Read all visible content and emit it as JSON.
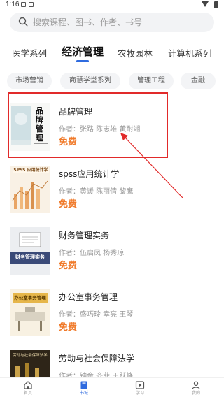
{
  "status_bar": {
    "time": "1:16"
  },
  "search": {
    "placeholder": "搜索课程、图书、作者、书号"
  },
  "categories": [
    {
      "label": "医学系列",
      "active": false
    },
    {
      "label": "经济管理",
      "active": true
    },
    {
      "label": "农牧园林",
      "active": false
    },
    {
      "label": "计算机系列",
      "active": false
    }
  ],
  "chips": [
    "市场营销",
    "商慧学堂系列",
    "管理工程",
    "金融"
  ],
  "books": [
    {
      "title": "品牌管理",
      "author": "作者：张路 陈志雄 黄耐湘",
      "price": "免费",
      "cover_text": "品牌管理"
    },
    {
      "title": "spss应用统计学",
      "author": "作者：黄谖 陈丽倩 黎鹰",
      "price": "免费",
      "cover_text": "SPSS 应用统计学"
    },
    {
      "title": "财务管理实务",
      "author": "作者：伍启凤 杨秀琼",
      "price": "免费",
      "cover_text": "财务管理实务"
    },
    {
      "title": "办公室事务管理",
      "author": "作者：盛巧玲 幸亮 王琴",
      "price": "免费",
      "cover_text": "办公室事务管理"
    },
    {
      "title": "劳动与社会保障法学",
      "author": "作者：钟金 齐菲 王跃峰",
      "price": "免费",
      "cover_text": "劳动与社会保障法学"
    }
  ],
  "bottom_nav": [
    {
      "label": "首页",
      "icon": "home-icon",
      "active": false
    },
    {
      "label": "书城",
      "icon": "book-icon",
      "active": true
    },
    {
      "label": "学习",
      "icon": "play-icon",
      "active": false
    },
    {
      "label": "我的",
      "icon": "user-icon",
      "active": false
    }
  ],
  "colors": {
    "accent": "#2f6bdf",
    "price": "#f07a2a",
    "highlight": "#e12a2a"
  }
}
